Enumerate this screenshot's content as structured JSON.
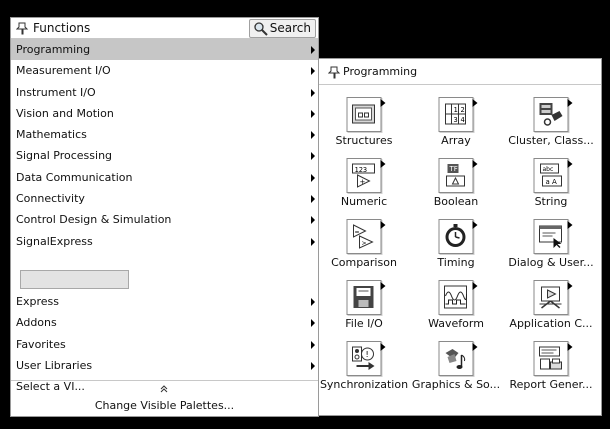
{
  "functions_palette": {
    "title": "Functions",
    "search_label": "Search",
    "items": [
      {
        "label": "Programming",
        "has_submenu": true,
        "selected": true
      },
      {
        "label": "Measurement I/O",
        "has_submenu": true
      },
      {
        "label": "Instrument I/O",
        "has_submenu": true
      },
      {
        "label": "Vision and Motion",
        "has_submenu": true
      },
      {
        "label": "Mathematics",
        "has_submenu": true
      },
      {
        "label": "Signal Processing",
        "has_submenu": true
      },
      {
        "label": "Data Communication",
        "has_submenu": true
      },
      {
        "label": "Connectivity",
        "has_submenu": true
      },
      {
        "label": "Control Design & Simulation",
        "has_submenu": true
      },
      {
        "label": "SignalExpress",
        "has_submenu": true
      }
    ],
    "items2": [
      {
        "label": "Express",
        "has_submenu": true
      },
      {
        "label": "Addons",
        "has_submenu": true
      },
      {
        "label": "Favorites",
        "has_submenu": true
      },
      {
        "label": "User Libraries",
        "has_submenu": true
      },
      {
        "label": "Select a VI...",
        "has_submenu": false
      }
    ],
    "footer": {
      "expand_symbol": "Å",
      "change_label": "Change Visible Palettes..."
    }
  },
  "programming_palette": {
    "title": "Programming",
    "cells": [
      {
        "label": "Structures",
        "icon": "structures-icon"
      },
      {
        "label": "Array",
        "icon": "array-icon"
      },
      {
        "label": "Cluster, Class...",
        "icon": "cluster-icon"
      },
      {
        "label": "Numeric",
        "icon": "numeric-icon"
      },
      {
        "label": "Boolean",
        "icon": "boolean-icon"
      },
      {
        "label": "String",
        "icon": "string-icon"
      },
      {
        "label": "Comparison",
        "icon": "comparison-icon"
      },
      {
        "label": "Timing",
        "icon": "timing-icon"
      },
      {
        "label": "Dialog & User...",
        "icon": "dialog-icon"
      },
      {
        "label": "File I/O",
        "icon": "file-io-icon"
      },
      {
        "label": "Waveform",
        "icon": "waveform-icon"
      },
      {
        "label": "Application C...",
        "icon": "application-control-icon"
      },
      {
        "label": "Synchronization",
        "icon": "synchronization-icon"
      },
      {
        "label": "Graphics & So...",
        "icon": "graphics-sound-icon"
      },
      {
        "label": "Report Gener...",
        "icon": "report-generation-icon"
      }
    ]
  }
}
